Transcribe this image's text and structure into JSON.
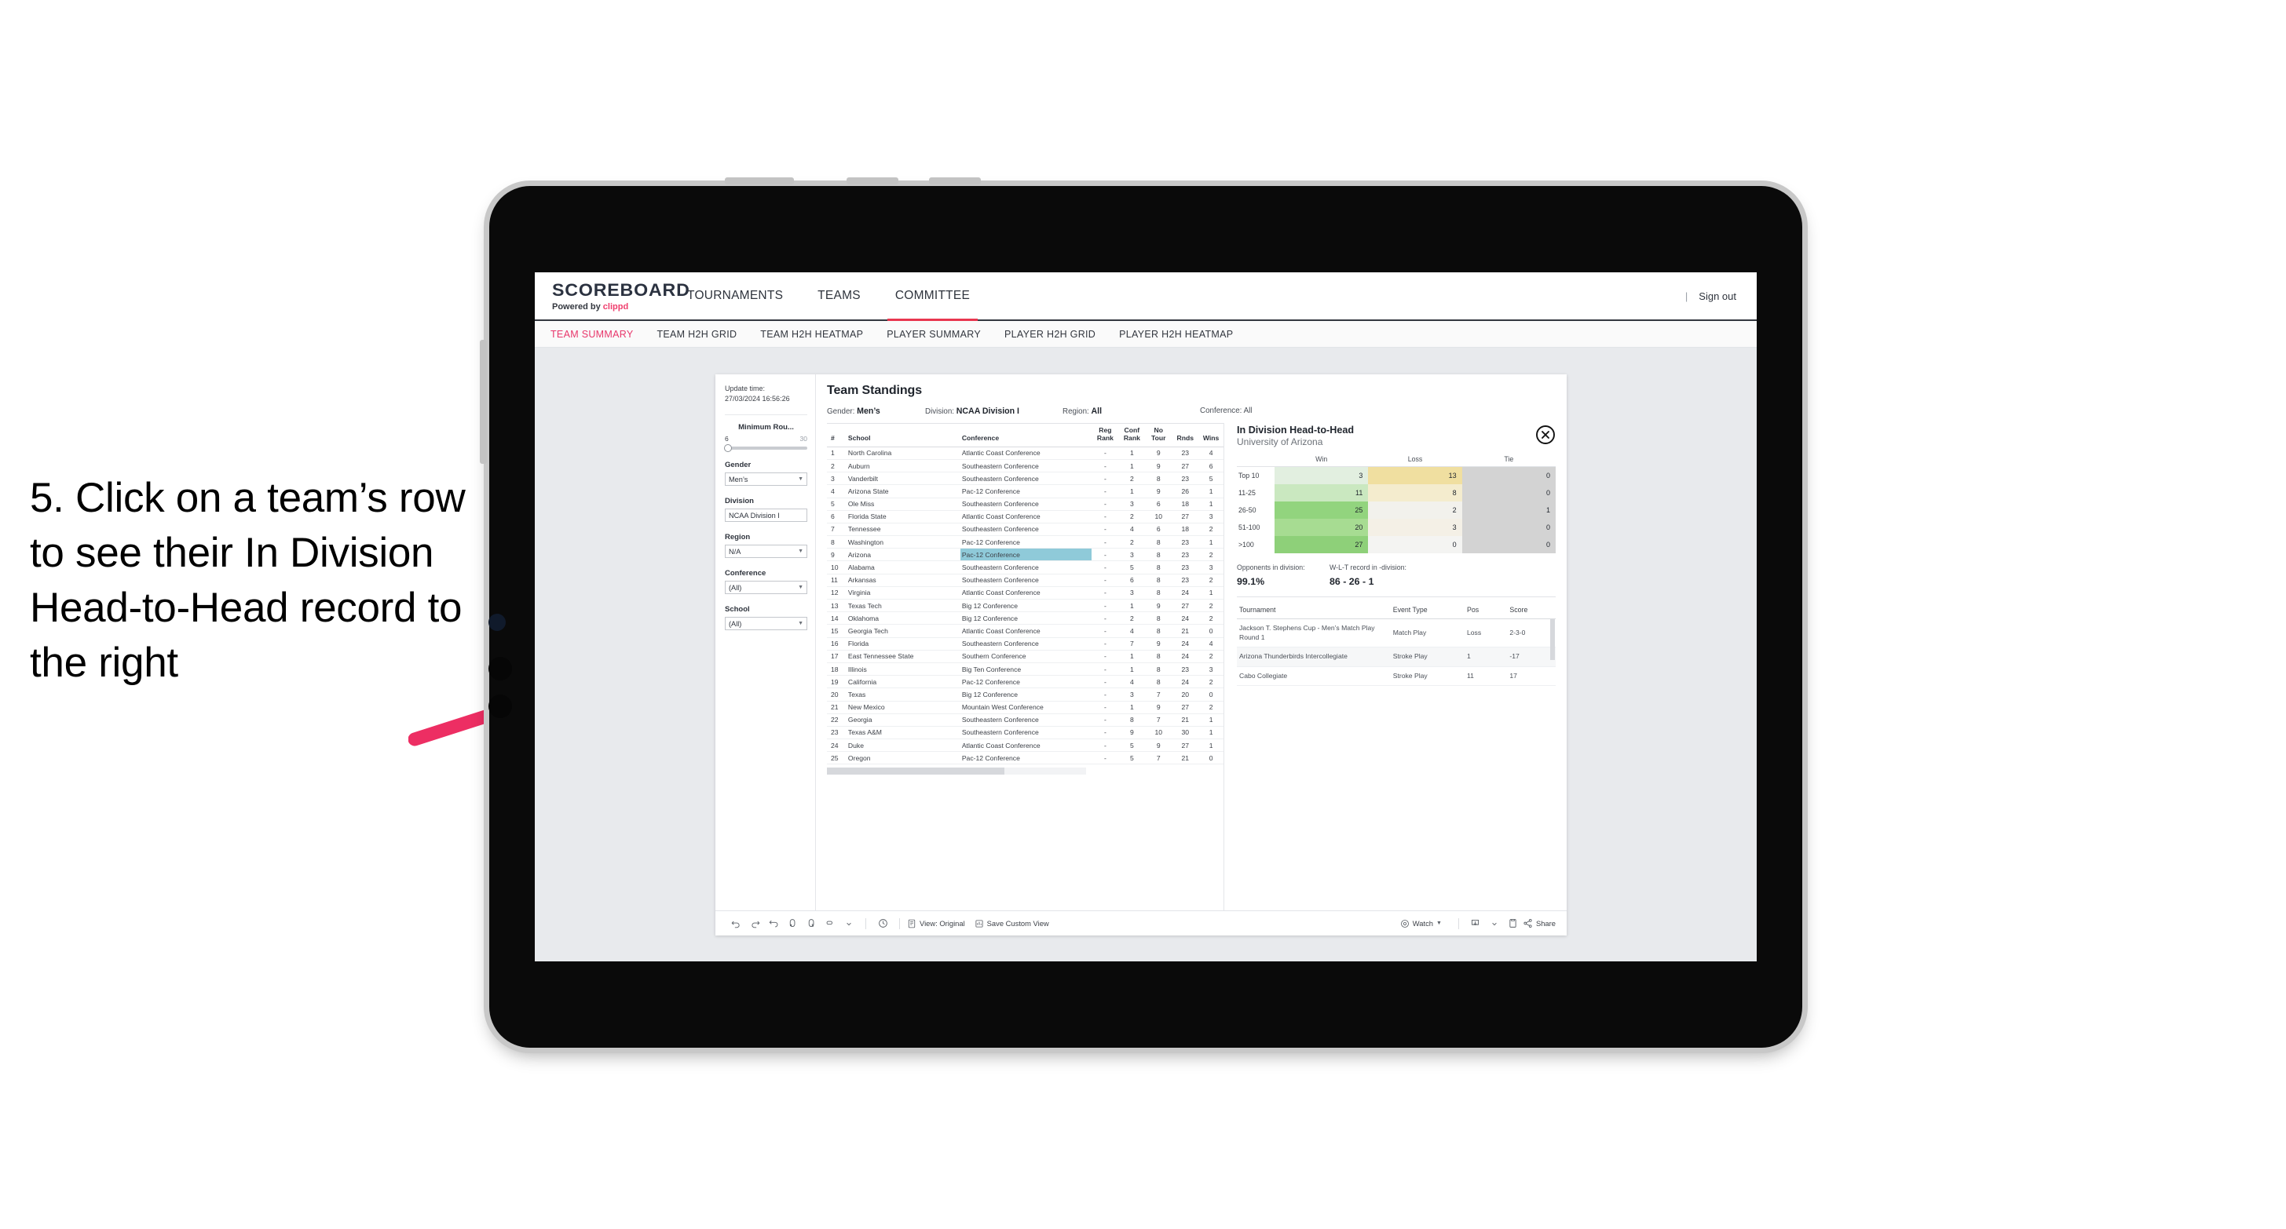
{
  "annotation": {
    "text": "5. Click on a team’s row to see their In Division Head-to-Head record to the right",
    "arrow_color": "#ed2e63"
  },
  "app": {
    "logo": {
      "word": "SCOREBOARD",
      "powered_prefix": "Powered by ",
      "powered_brand": "clippd"
    },
    "top_nav": [
      {
        "label": "TOURNAMENTS",
        "active": false
      },
      {
        "label": "TEAMS",
        "active": false
      },
      {
        "label": "COMMITTEE",
        "active": true
      }
    ],
    "sign_out": "Sign out",
    "divider": "|",
    "sub_nav": [
      {
        "label": "TEAM SUMMARY",
        "active": true
      },
      {
        "label": "TEAM H2H GRID",
        "active": false
      },
      {
        "label": "TEAM H2H HEATMAP",
        "active": false
      },
      {
        "label": "PLAYER SUMMARY",
        "active": false
      },
      {
        "label": "PLAYER H2H GRID",
        "active": false
      },
      {
        "label": "PLAYER H2H HEATMAP",
        "active": false
      }
    ]
  },
  "filters": {
    "update_time_label": "Update time:",
    "update_time_value": "27/03/2024 16:56:26",
    "slider": {
      "title": "Minimum Rou...",
      "min": "6",
      "max": "30"
    },
    "groups": [
      {
        "title": "Gender",
        "value": "Men’s"
      },
      {
        "title": "Division",
        "value": "NCAA Division I"
      },
      {
        "title": "Region",
        "value": "N/A"
      },
      {
        "title": "Conference",
        "value": "(All)"
      },
      {
        "title": "School",
        "value": "(All)"
      }
    ]
  },
  "viz": {
    "title": "Team Standings",
    "summary": [
      {
        "label": "Gender: ",
        "value": "Men’s"
      },
      {
        "label": "Division: ",
        "value": "NCAA Division I"
      },
      {
        "label": "Region: ",
        "value": "All"
      },
      {
        "label": "Conference: ",
        "value": "All"
      }
    ]
  },
  "standings": {
    "columns": [
      "#",
      "School",
      "Conference",
      "Reg Rank",
      "Conf Rank",
      "No Tour",
      "Rnds",
      "Wins"
    ],
    "selected_rank": 9,
    "selected_highlight_color": "#8fcad9",
    "rows": [
      {
        "rank": "1",
        "school": "North Carolina",
        "conference": "Atlantic Coast Conference",
        "reg": "-",
        "conf": "1",
        "notour": "9",
        "rnds": "23",
        "wins": "4"
      },
      {
        "rank": "2",
        "school": "Auburn",
        "conference": "Southeastern Conference",
        "reg": "-",
        "conf": "1",
        "notour": "9",
        "rnds": "27",
        "wins": "6"
      },
      {
        "rank": "3",
        "school": "Vanderbilt",
        "conference": "Southeastern Conference",
        "reg": "-",
        "conf": "2",
        "notour": "8",
        "rnds": "23",
        "wins": "5"
      },
      {
        "rank": "4",
        "school": "Arizona State",
        "conference": "Pac-12 Conference",
        "reg": "-",
        "conf": "1",
        "notour": "9",
        "rnds": "26",
        "wins": "1"
      },
      {
        "rank": "5",
        "school": "Ole Miss",
        "conference": "Southeastern Conference",
        "reg": "-",
        "conf": "3",
        "notour": "6",
        "rnds": "18",
        "wins": "1"
      },
      {
        "rank": "6",
        "school": "Florida State",
        "conference": "Atlantic Coast Conference",
        "reg": "-",
        "conf": "2",
        "notour": "10",
        "rnds": "27",
        "wins": "3"
      },
      {
        "rank": "7",
        "school": "Tennessee",
        "conference": "Southeastern Conference",
        "reg": "-",
        "conf": "4",
        "notour": "6",
        "rnds": "18",
        "wins": "2"
      },
      {
        "rank": "8",
        "school": "Washington",
        "conference": "Pac-12 Conference",
        "reg": "-",
        "conf": "2",
        "notour": "8",
        "rnds": "23",
        "wins": "1"
      },
      {
        "rank": "9",
        "school": "Arizona",
        "conference": "Pac-12 Conference",
        "reg": "-",
        "conf": "3",
        "notour": "8",
        "rnds": "23",
        "wins": "2"
      },
      {
        "rank": "10",
        "school": "Alabama",
        "conference": "Southeastern Conference",
        "reg": "-",
        "conf": "5",
        "notour": "8",
        "rnds": "23",
        "wins": "3"
      },
      {
        "rank": "11",
        "school": "Arkansas",
        "conference": "Southeastern Conference",
        "reg": "-",
        "conf": "6",
        "notour": "8",
        "rnds": "23",
        "wins": "2"
      },
      {
        "rank": "12",
        "school": "Virginia",
        "conference": "Atlantic Coast Conference",
        "reg": "-",
        "conf": "3",
        "notour": "8",
        "rnds": "24",
        "wins": "1"
      },
      {
        "rank": "13",
        "school": "Texas Tech",
        "conference": "Big 12 Conference",
        "reg": "-",
        "conf": "1",
        "notour": "9",
        "rnds": "27",
        "wins": "2"
      },
      {
        "rank": "14",
        "school": "Oklahoma",
        "conference": "Big 12 Conference",
        "reg": "-",
        "conf": "2",
        "notour": "8",
        "rnds": "24",
        "wins": "2"
      },
      {
        "rank": "15",
        "school": "Georgia Tech",
        "conference": "Atlantic Coast Conference",
        "reg": "-",
        "conf": "4",
        "notour": "8",
        "rnds": "21",
        "wins": "0"
      },
      {
        "rank": "16",
        "school": "Florida",
        "conference": "Southeastern Conference",
        "reg": "-",
        "conf": "7",
        "notour": "9",
        "rnds": "24",
        "wins": "4"
      },
      {
        "rank": "17",
        "school": "East Tennessee State",
        "conference": "Southern Conference",
        "reg": "-",
        "conf": "1",
        "notour": "8",
        "rnds": "24",
        "wins": "2"
      },
      {
        "rank": "18",
        "school": "Illinois",
        "conference": "Big Ten Conference",
        "reg": "-",
        "conf": "1",
        "notour": "8",
        "rnds": "23",
        "wins": "3"
      },
      {
        "rank": "19",
        "school": "California",
        "conference": "Pac-12 Conference",
        "reg": "-",
        "conf": "4",
        "notour": "8",
        "rnds": "24",
        "wins": "2"
      },
      {
        "rank": "20",
        "school": "Texas",
        "conference": "Big 12 Conference",
        "reg": "-",
        "conf": "3",
        "notour": "7",
        "rnds": "20",
        "wins": "0"
      },
      {
        "rank": "21",
        "school": "New Mexico",
        "conference": "Mountain West Conference",
        "reg": "-",
        "conf": "1",
        "notour": "9",
        "rnds": "27",
        "wins": "2"
      },
      {
        "rank": "22",
        "school": "Georgia",
        "conference": "Southeastern Conference",
        "reg": "-",
        "conf": "8",
        "notour": "7",
        "rnds": "21",
        "wins": "1"
      },
      {
        "rank": "23",
        "school": "Texas A&M",
        "conference": "Southeastern Conference",
        "reg": "-",
        "conf": "9",
        "notour": "10",
        "rnds": "30",
        "wins": "1"
      },
      {
        "rank": "24",
        "school": "Duke",
        "conference": "Atlantic Coast Conference",
        "reg": "-",
        "conf": "5",
        "notour": "9",
        "rnds": "27",
        "wins": "1"
      },
      {
        "rank": "25",
        "school": "Oregon",
        "conference": "Pac-12 Conference",
        "reg": "-",
        "conf": "5",
        "notour": "7",
        "rnds": "21",
        "wins": "0"
      }
    ]
  },
  "detail": {
    "title": "In Division Head-to-Head",
    "subtitle": "University of Arizona",
    "close_icon": "close-circle-icon",
    "chart_data": {
      "type": "heatmap",
      "title": "In Division Head-to-Head",
      "columns": [
        "Win",
        "Loss",
        "Tie"
      ],
      "categories": [
        "Top 10",
        "11-25",
        "26-50",
        "51-100",
        ">100"
      ],
      "rows": [
        {
          "label": "Top 10",
          "win": 3,
          "loss": 13,
          "tie": 0,
          "win_color": "#e2efe0",
          "loss_color": "#f0dfa0",
          "tie_color": "#d3d3d3"
        },
        {
          "label": "11-25",
          "win": 11,
          "loss": 8,
          "tie": 0,
          "win_color": "#cae8c0",
          "loss_color": "#f4ecce",
          "tie_color": "#d3d3d3"
        },
        {
          "label": "26-50",
          "win": 25,
          "loss": 2,
          "tie": 1,
          "win_color": "#92d47e",
          "loss_color": "#f2f1ec",
          "tie_color": "#d3d3d3"
        },
        {
          "label": "51-100",
          "win": 20,
          "loss": 3,
          "tie": 0,
          "win_color": "#a7dc92",
          "loss_color": "#f4f0e6",
          "tie_color": "#d3d3d3"
        },
        {
          "label": ">100",
          "win": 27,
          "loss": 0,
          "tie": 0,
          "win_color": "#8ed079",
          "loss_color": "#f4f4f2",
          "tie_color": "#d3d3d3"
        }
      ]
    },
    "stats": [
      {
        "label": "Opponents in division:",
        "value": "99.1%"
      },
      {
        "label": "W-L-T record in -division:",
        "value": "86 - 26 - 1"
      }
    ],
    "tournaments": {
      "columns": [
        "Tournament",
        "Event Type",
        "Pos",
        "Score"
      ],
      "rows": [
        {
          "name": "Jackson T. Stephens Cup - Men’s Match Play Round 1",
          "type": "Match Play",
          "pos": "Loss",
          "score": "2-3-0"
        },
        {
          "name": "Arizona Thunderbirds Intercollegiate",
          "type": "Stroke Play",
          "pos": "1",
          "score": "-17"
        },
        {
          "name": "Cabo Collegiate",
          "type": "Stroke Play",
          "pos": "11",
          "score": "17"
        }
      ]
    }
  },
  "toolbar": {
    "view_label": "View: Original",
    "save_label": "Save Custom View",
    "watch_label": "Watch",
    "share_label": "Share"
  }
}
